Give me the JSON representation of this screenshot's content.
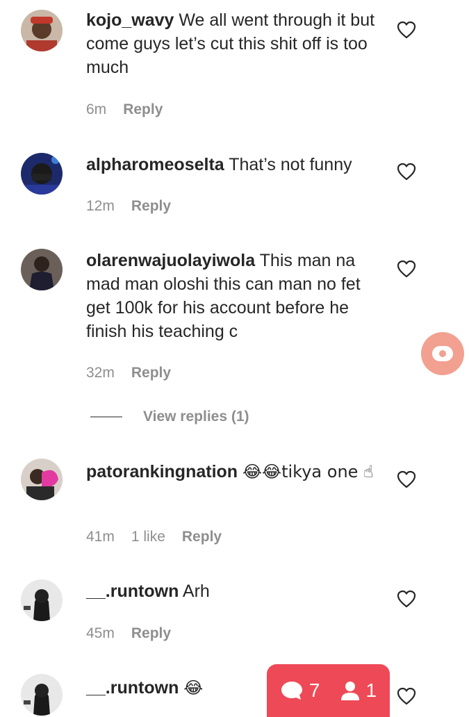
{
  "comments": [
    {
      "username": "kojo_wavy",
      "text": "We all went through it but come guys let’s cut this shit off is too much",
      "time": "6m",
      "likes": "",
      "reply_label": "Reply"
    },
    {
      "username": "alpharomeoselta",
      "text": "That’s not funny",
      "time": "12m",
      "likes": "",
      "reply_label": "Reply"
    },
    {
      "username": "olarenwajuolayiwola",
      "text": "This man na mad man oloshi this can man no fet get 100k for his account before he finish his teaching c",
      "time": "32m",
      "likes": "",
      "reply_label": "Reply"
    },
    {
      "username": "patorankingnation",
      "text": "😂😂tikya one ☝",
      "time": "41m",
      "likes": "1 like",
      "reply_label": "Reply"
    },
    {
      "username": "__.runtown",
      "text": "Arh",
      "time": "45m",
      "likes": "",
      "reply_label": "Reply"
    },
    {
      "username": "__.runtown",
      "text": "😂",
      "time": "",
      "likes": "",
      "reply_label": ""
    }
  ],
  "view_replies": "View replies (1)",
  "stats": {
    "comment_count": "7",
    "follower_count": "1"
  },
  "colors": {
    "notification_pill": "#ee4956",
    "floating_button": "#f2a090",
    "meta_text": "#8e8e8e"
  }
}
